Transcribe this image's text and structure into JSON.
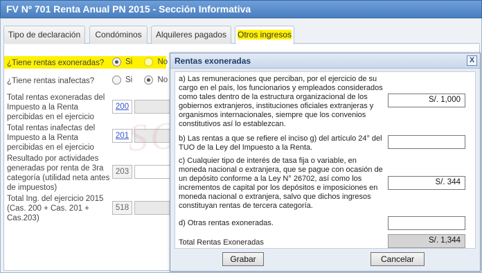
{
  "window": {
    "title": "FV Nº 701 Renta Anual PN 2015 - Sección Informativa"
  },
  "tabs": [
    {
      "label": "Tipo de declaración"
    },
    {
      "label": "Condóminos"
    },
    {
      "label": "Alquileres pagados"
    },
    {
      "label": "Otros ingresos"
    }
  ],
  "form": {
    "q1": {
      "label": "¿Tiene rentas exoneradas?",
      "yes": "Si",
      "no": "No"
    },
    "q2": {
      "label": "¿Tiene rentas inafectas?",
      "yes": "Si",
      "no": "No"
    },
    "rows": [
      {
        "label": "Total rentas exoneradas del Impuesto a la Renta percibidas en el ejercicio",
        "code": "200"
      },
      {
        "label": "Total rentas inafectas del Impuesto a la Renta percibidas en el ejercicio",
        "code": "201"
      },
      {
        "label": "Resultado por actividades generadas por renta de 3ra categoría (utilidad neta antes de impuestos)",
        "code": "203"
      },
      {
        "label": "Total Ing. del ejercicio 2015 (Cas. 200 + Cas. 201 + Cas.203)",
        "code": "518"
      }
    ]
  },
  "watermark": "SOCRATIN",
  "modal": {
    "title": "Rentas exoneradas",
    "close": "X",
    "items": [
      {
        "text": "a) Las remuneraciones que perciban, por el ejercicio de su cargo en el país, los funcionarios y empleados considerados como tales dentro de la estructura organizacional de los gobiernos extranjeros, instituciones oficiales extranjeras y organismos internacionales, siempre que los convenios constitutivos así lo establezcan.",
        "value": "S/. 1,000"
      },
      {
        "text": "b) Las rentas a que se refiere el inciso g) del artículo 24° del TUO de la Ley del Impuesto a la Renta.",
        "value": ""
      },
      {
        "text": "c) Cualquier tipo de interés de tasa fija o variable, en moneda nacional o extranjera, que se pague con ocasión de un depósito conforme a la Ley N° 26702, así como los incrementos de capital por los depósitos e imposiciones en moneda nacional o extranjera, salvo que dichos ingresos constituyan rentas de tercera categoría.",
        "value": "S/. 344"
      },
      {
        "text": "d) Otras rentas exoneradas.",
        "value": ""
      }
    ],
    "total_label": "Total Rentas Exoneradas",
    "total_value": "S/. 1,344",
    "save": "Grabar",
    "cancel": "Cancelar"
  }
}
